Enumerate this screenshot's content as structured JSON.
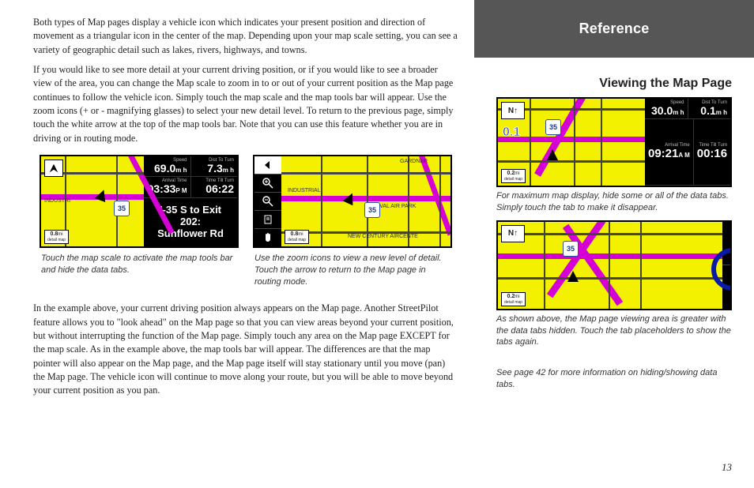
{
  "header": {
    "banner": "Reference",
    "section_title": "Viewing the Map Page"
  },
  "body": {
    "para1": "Both types of Map pages display a vehicle icon which indicates your present position and direction of movement as a triangular icon in the center of the map. Depending upon your map scale setting, you can see a variety of geographic detail such as lakes, rivers, highways, and towns.",
    "para2": "If you would like to see more detail at your current driving position, or if you would like to see a broader view of the area, you can change the Map scale to zoom in to or out of your current position as the Map page continues to follow the vehicle icon. Simply touch the map scale and the map tools bar will appear. Use the zoom icons (+ or - magnifying glasses) to select your new detail level. To return to the previous page, simply touch the white arrow at the top of the map tools bar. Note that you can use this feature whether you are in driving or in routing mode.",
    "para3": "In the example above, your current driving position always appears on the Map page. Another StreetPilot feature allows you to \"look ahead\" on the Map page so that you can view areas beyond your current position, but without interrupting the function of the Map page. Simply touch any area on the Map page EXCEPT for the map scale. As in the example above, the map tools bar will appear. The differences are that the map pointer will also appear on the Map page, and the Map page itself will stay stationary until you move (pan) the Map page. The vehicle icon will continue to move along your route, but you will be able to move beyond your current position as you pan."
  },
  "captions": {
    "left_fig1": "Touch the map scale to activate the map tools bar and hide the data tabs.",
    "left_fig2": "Use the zoom icons to view a new level of detail. Touch the arrow to return to the Map page in routing mode.",
    "right_fig1": "For maximum map display, hide some or all of the data tabs. Simply touch the tab to make it disappear.",
    "right_fig2": "As shown above, the Map page viewing area is greater with the data tabs hidden. Touch the tab placeholders to show the tabs again.",
    "footnote": "See page 42 for more information on hiding/showing data tabs."
  },
  "maps": {
    "left1": {
      "compass_dir": "↖",
      "scale": "0.8",
      "scale_unit": "mi",
      "scale_sub": "detail map",
      "speed_label": "Speed",
      "speed": "69.0",
      "speed_unit": "m h",
      "dist_label": "Dist To Turn",
      "dist": "7.3",
      "dist_unit": "m h",
      "arrival_label": "Arrival Time",
      "arrival": "03:33",
      "arrival_ampm": "P M",
      "time_label": "Time Till Turn",
      "time": "06:22",
      "route1": "I-35 S to Exit",
      "route2": "202:",
      "route3": "Sunflower Rd",
      "street1": "INDUSTRI",
      "shield1": "35"
    },
    "left2": {
      "compass_dir": "←",
      "scale": "0.8",
      "scale_unit": "mi",
      "scale_sub": "detail map",
      "street1": "INDUSTRIAL",
      "street2": "NAVAL AIR PARK",
      "street3": "NEW CENTURY AIRCENTE",
      "street4": "GARDNER",
      "shield1": "35"
    },
    "right1": {
      "compass_dir": "N↑",
      "scale": "0.2",
      "scale_unit": "mi",
      "scale_sub": "detail map",
      "speed_label": "Speed",
      "speed": "30.0",
      "speed_unit": "m h",
      "dist_label": "Dist To Turn",
      "dist": "0.1",
      "dist_unit": "m h",
      "arrival_label": "Arrival Time",
      "arrival": "09:21",
      "arrival_ampm": "A M",
      "time_label": "Time Till Turn",
      "time": "00:16",
      "point": "0.1",
      "shield1": "35"
    },
    "right2": {
      "compass_dir": "N↑",
      "scale": "0.2",
      "scale_unit": "mi",
      "scale_sub": "detail map",
      "shield1": "35"
    }
  },
  "page_number": "13"
}
